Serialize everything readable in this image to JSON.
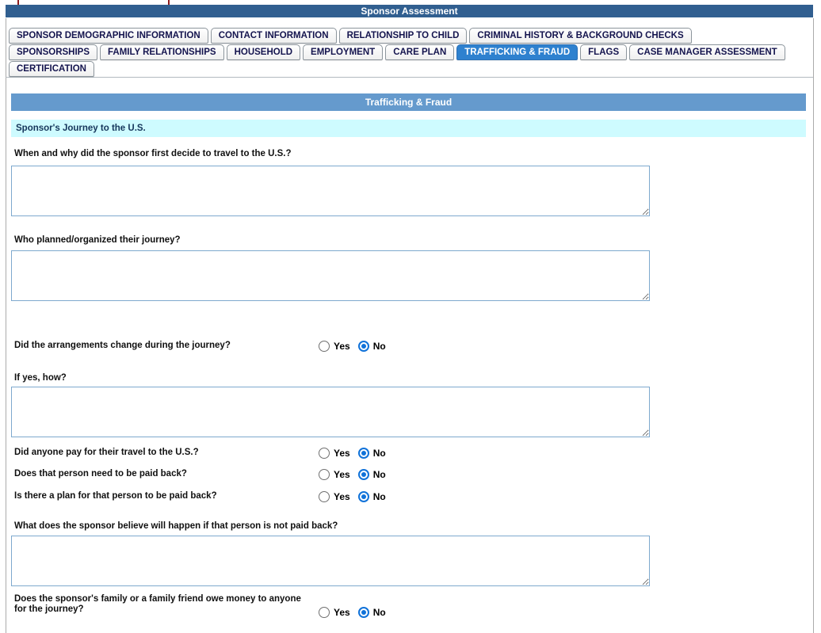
{
  "title": "Sponsor Assessment",
  "colors": {
    "titlebar_bg": "#315f90",
    "active_tab_bg": "#2e81cf",
    "section_header_bg": "#659acd",
    "subsection_bg": "#cefbff",
    "textarea_border": "#7ea9ce",
    "radio_checked": "#1072d9",
    "cutoff_border": "#8e1b1b"
  },
  "tabs": [
    {
      "label": "SPONSOR DEMOGRAPHIC INFORMATION",
      "row": 1,
      "active": false
    },
    {
      "label": "CONTACT INFORMATION",
      "row": 1,
      "active": false
    },
    {
      "label": "RELATIONSHIP TO CHILD",
      "row": 1,
      "active": false
    },
    {
      "label": "CRIMINAL HISTORY & BACKGROUND CHECKS",
      "row": 1,
      "active": false
    },
    {
      "label": "SPONSORSHIPS",
      "row": 2,
      "active": false
    },
    {
      "label": "FAMILY RELATIONSHIPS",
      "row": 2,
      "active": false
    },
    {
      "label": "HOUSEHOLD",
      "row": 2,
      "active": false
    },
    {
      "label": "EMPLOYMENT",
      "row": 2,
      "active": false
    },
    {
      "label": "CARE PLAN",
      "row": 2,
      "active": false
    },
    {
      "label": "TRAFFICKING & FRAUD",
      "row": 2,
      "active": true
    },
    {
      "label": "FLAGS",
      "row": 2,
      "active": false
    },
    {
      "label": "CASE MANAGER ASSESSMENT",
      "row": 2,
      "active": false
    },
    {
      "label": "CERTIFICATION",
      "row": 3,
      "active": false
    }
  ],
  "section": {
    "title": "Trafficking & Fraud",
    "subsection": "Sponsor's Journey to the U.S."
  },
  "questions": [
    {
      "label": "When and why did the sponsor first decide to travel to the U.S.?",
      "type": "textarea",
      "value": ""
    },
    {
      "label": "Who planned/organized their journey?",
      "type": "textarea",
      "value": ""
    },
    {
      "label": "Did the arrangements change during the journey?",
      "type": "radio",
      "options": [
        "Yes",
        "No"
      ],
      "selected": "No"
    },
    {
      "label": "If yes, how?",
      "type": "textarea",
      "value": ""
    },
    {
      "label": "Did anyone pay for their travel to the U.S.?",
      "type": "radio",
      "options": [
        "Yes",
        "No"
      ],
      "selected": "No"
    },
    {
      "label": "Does that person need to be paid back?",
      "type": "radio",
      "options": [
        "Yes",
        "No"
      ],
      "selected": "No"
    },
    {
      "label": "Is there a plan for that person to be paid back?",
      "type": "radio",
      "options": [
        "Yes",
        "No"
      ],
      "selected": "No"
    },
    {
      "label": "What does the sponsor believe will happen if that person is not paid back?",
      "type": "textarea",
      "value": ""
    },
    {
      "label": "Does the sponsor's family or a family friend owe money to anyone for the journey?",
      "type": "radio",
      "options": [
        "Yes",
        "No"
      ],
      "selected": "No"
    }
  ]
}
